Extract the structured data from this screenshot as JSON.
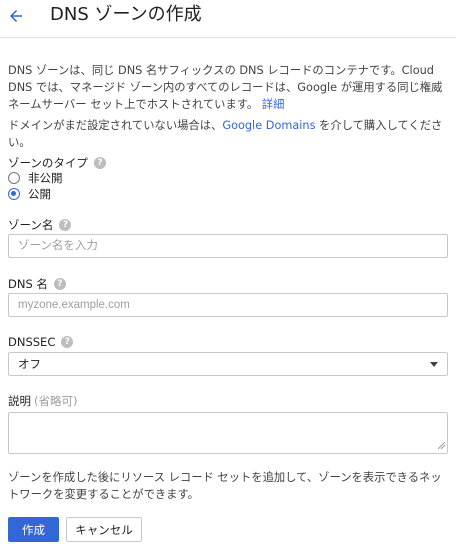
{
  "header": {
    "title": "DNS ゾーンの作成",
    "back_icon": "arrow-back-icon"
  },
  "intro": {
    "text": "DNS ゾーンは、同じ DNS 名サフィックスの DNS レコードのコンテナです。Cloud DNS では、マネージド ゾーン内のすべてのレコードは、Google が運用する同じ権威ネームサーバー セット上でホストされています。",
    "link_label": "詳細"
  },
  "domain_notice": {
    "before": "ドメインがまだ設定されていない場合は、",
    "link_label": "Google Domains",
    "after": " を介して購入してください。"
  },
  "zone_type": {
    "label": "ゾーンのタイプ",
    "options": [
      {
        "label": "非公開",
        "checked": false
      },
      {
        "label": "公開",
        "checked": true
      }
    ]
  },
  "zone_name": {
    "label": "ゾーン名",
    "placeholder": "ゾーン名を入力",
    "value": ""
  },
  "dns_name": {
    "label": "DNS 名",
    "placeholder": "myzone.example.com",
    "value": ""
  },
  "dnssec": {
    "label": "DNSSEC",
    "selected": "オフ"
  },
  "description": {
    "label": "説明",
    "optional": "(省略可)",
    "value": ""
  },
  "footer": {
    "text": "ゾーンを作成した後にリソース レコード セットを追加して、ゾーンを表示できるネットワークを変更することができます。"
  },
  "actions": {
    "create_label": "作成",
    "cancel_label": "キャンセル"
  },
  "colors": {
    "accent": "#3367d6",
    "border": "#c9c9c9",
    "help_icon": "#bdbdbd"
  }
}
